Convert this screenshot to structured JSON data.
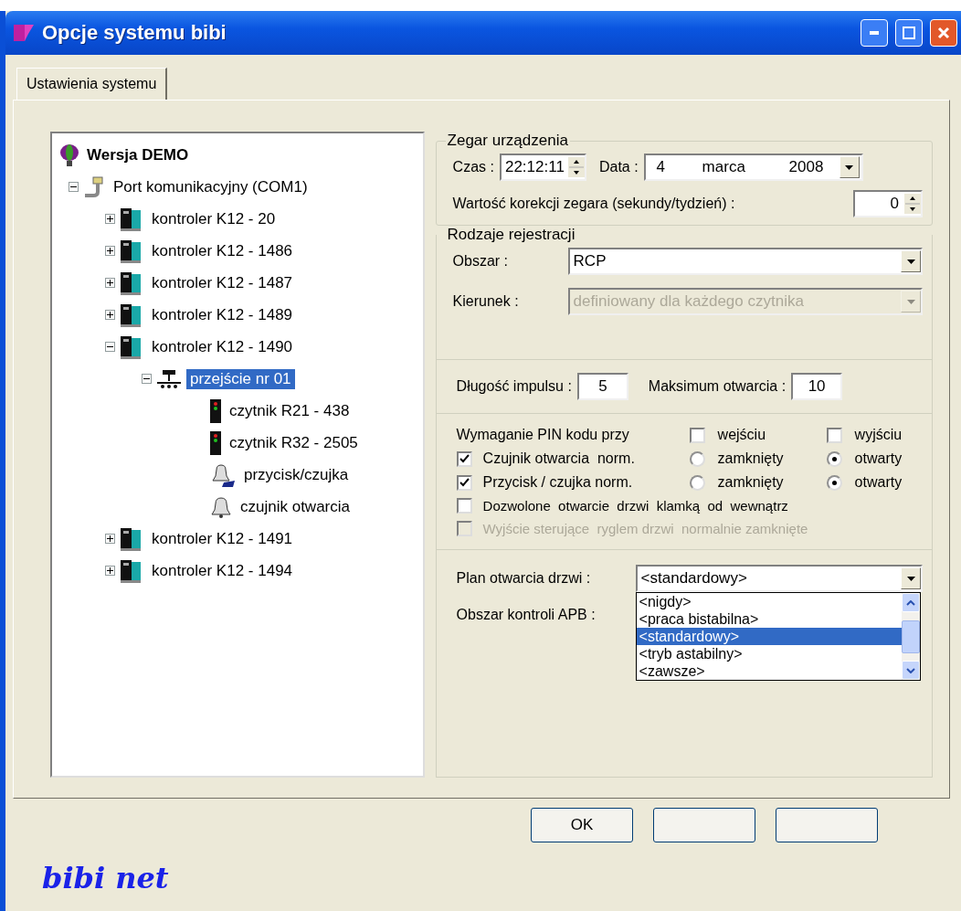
{
  "window": {
    "title": "Opcje systemu bibi"
  },
  "tabs": [
    {
      "label": "Ustawienia systemu",
      "selected": true
    }
  ],
  "tree": [
    {
      "label": "Wersja DEMO",
      "kind": "root",
      "selected": false,
      "children": [
        {
          "label": "Port komunikacyjny (COM1)",
          "kind": "port",
          "expanded": true,
          "selected": false,
          "children": [
            {
              "label": "kontroler K12 - 20",
              "kind": "controller",
              "expanded": false,
              "selected": false
            },
            {
              "label": "kontroler K12 - 1486",
              "kind": "controller",
              "expanded": false,
              "selected": false
            },
            {
              "label": "kontroler K12 - 1487",
              "kind": "controller",
              "expanded": false,
              "selected": false
            },
            {
              "label": "kontroler K12 - 1489",
              "kind": "controller",
              "expanded": false,
              "selected": false
            },
            {
              "label": "kontroler K12 - 1490",
              "kind": "controller",
              "expanded": true,
              "selected": false,
              "children": [
                {
                  "label": "przejście nr 01",
                  "kind": "gate",
                  "expanded": true,
                  "selected": true,
                  "children": [
                    {
                      "label": "czytnik R21 - 438",
                      "kind": "reader",
                      "selected": false
                    },
                    {
                      "label": "czytnik R32 - 2505",
                      "kind": "reader",
                      "selected": false
                    },
                    {
                      "label": "przycisk/czujka",
                      "kind": "button",
                      "selected": false
                    },
                    {
                      "label": "czujnik otwarcia",
                      "kind": "sensor",
                      "selected": false
                    }
                  ]
                }
              ]
            },
            {
              "label": "kontroler K12 - 1491",
              "kind": "controller",
              "expanded": false,
              "selected": false
            },
            {
              "label": "kontroler K12 - 1494",
              "kind": "controller",
              "expanded": false,
              "selected": false
            }
          ]
        }
      ]
    }
  ],
  "clock": {
    "title": "Zegar urządzenia",
    "time_label": "Czas :",
    "time": "22:12:11",
    "date_label": "Data :",
    "day": "4",
    "month": "marca",
    "year": "2008",
    "correction_label": "Wartość korekcji zegara (sekundy/tydzień) :",
    "correction": "0"
  },
  "registration": {
    "title": "Rodzaje rejestracji",
    "fields": [
      {
        "label": "Obszar :",
        "value": "RCP",
        "disabled": false
      },
      {
        "label": "Kierunek :",
        "value": "definiowany dla każdego czytnika",
        "disabled": true
      }
    ]
  },
  "impulse": {
    "label": "Długość impulsu :",
    "value": "5",
    "max_label": "Maksimum otwarcia :",
    "max_value": "10"
  },
  "pin": {
    "label": "Wymaganie PIN kodu przy",
    "options": [
      {
        "label": "wejściu",
        "checked": false
      },
      {
        "label": "wyjściu",
        "checked": false
      }
    ]
  },
  "sensors": [
    {
      "label": "Czujnik otwarcia  norm.",
      "checked": true,
      "options": [
        {
          "label": "zamknięty",
          "selected": false
        },
        {
          "label": "otwarty",
          "selected": true
        }
      ]
    },
    {
      "label": "Przycisk / czujka norm.",
      "checked": true,
      "options": [
        {
          "label": "zamknięty",
          "selected": false
        },
        {
          "label": "otwarty",
          "selected": true
        }
      ]
    }
  ],
  "options": [
    {
      "label": "Dozwolone  otwarcie  drzwi  klamką  od  wewnątrz",
      "checked": false,
      "disabled": false
    },
    {
      "label": "Wyjście sterujące  ryglem drzwi  normalnie zamknięte",
      "checked": false,
      "disabled": true
    }
  ],
  "plan": {
    "label": "Plan otwarcia drzwi :",
    "value": "<standardowy>",
    "expanded": true,
    "list": [
      {
        "label": "<nigdy>",
        "selected": false
      },
      {
        "label": "<praca bistabilna>",
        "selected": false
      },
      {
        "label": "<standardowy>",
        "selected": true
      },
      {
        "label": "<tryb astabilny>",
        "selected": false
      },
      {
        "label": "<zawsze>",
        "selected": false
      }
    ]
  },
  "apb": {
    "label": "Obszar kontroli APB :"
  },
  "buttons": [
    {
      "kind": "text",
      "label": "OK"
    },
    {
      "kind": "covered"
    },
    {
      "kind": "covered"
    }
  ],
  "logo": {
    "text": "bibi net"
  }
}
